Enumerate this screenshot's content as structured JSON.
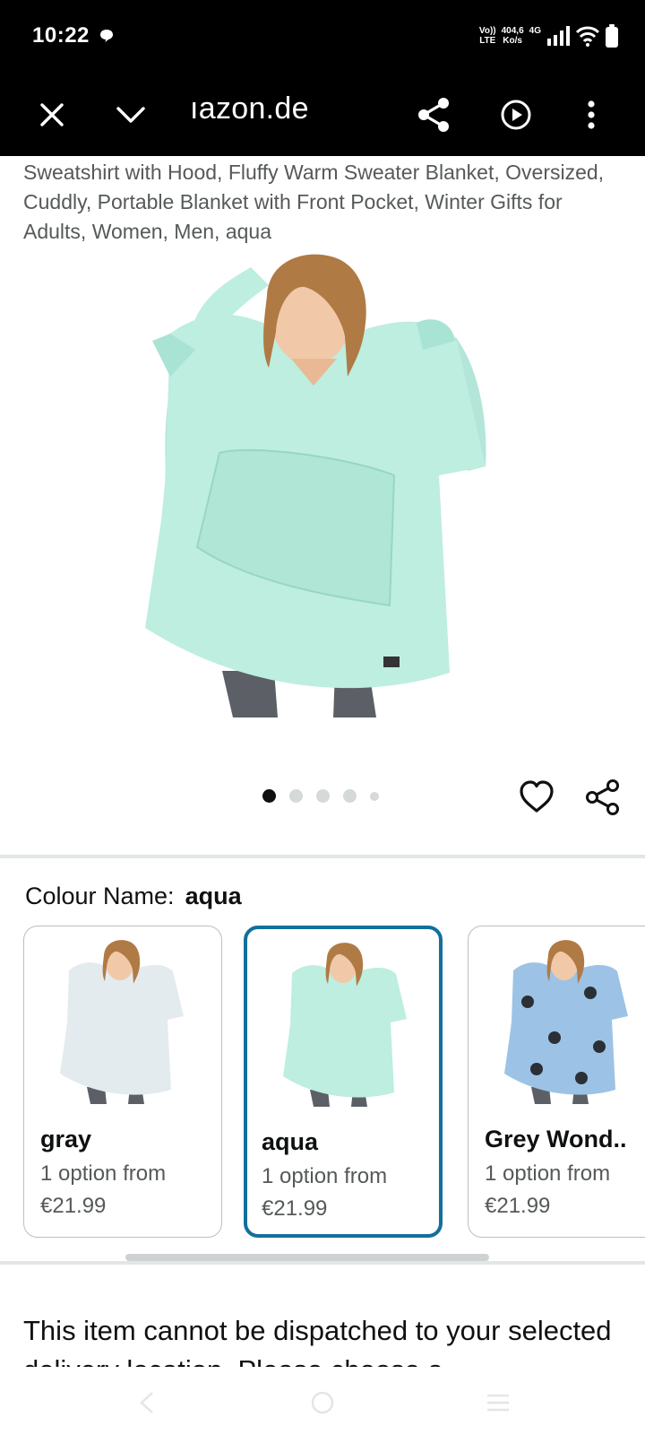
{
  "status": {
    "time": "10:22",
    "network_top": "Vo)) 404,6 4G",
    "volte": "Vo))",
    "lte": "LTE",
    "speed": "404,6",
    "speed_unit": "Ko/s",
    "network_type": "4G"
  },
  "browser": {
    "url": "ıazon.de",
    "icons": [
      "close-icon",
      "chevron-down-icon",
      "share-icon",
      "play-circle-icon",
      "more-vert-icon"
    ]
  },
  "product": {
    "title": "Sweatshirt with Hood, Fluffy Warm Sweater Blanket, Oversized, Cuddly, Portable Blanket with Front Pocket, Winter Gifts for Adults, Women, Men, aqua"
  },
  "carousel": {
    "total_dots": 5,
    "active_index": 0
  },
  "variation": {
    "label": "Colour Name:",
    "selected": "aqua",
    "options": [
      {
        "name": "gray",
        "availability": "1 option from",
        "price": "€21.99",
        "color": "#e4ebee"
      },
      {
        "name": "aqua",
        "availability": "1 option from",
        "price": "€21.99",
        "color": "#bdeee0"
      },
      {
        "name": "Grey Wond..",
        "availability": "1 option from",
        "price": "€21.99",
        "color": "#9cc3e6"
      }
    ]
  },
  "dispatch": {
    "text": "This item cannot be dispatched to your selected delivery location. Please choose a"
  }
}
